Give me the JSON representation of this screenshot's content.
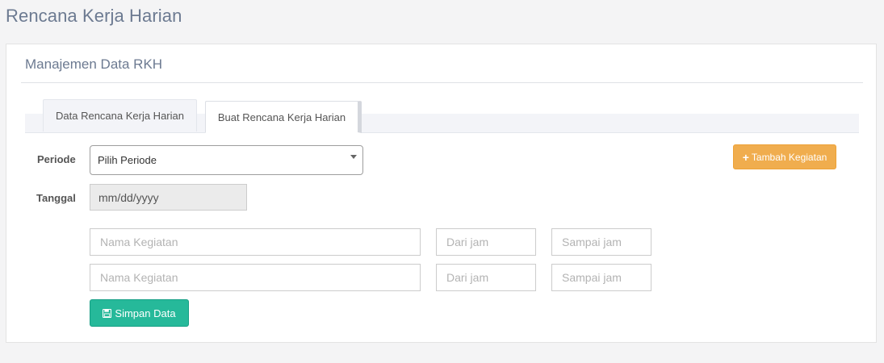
{
  "page": {
    "title": "Rencana Kerja Harian"
  },
  "card": {
    "title": "Manajemen Data RKH"
  },
  "tabs": [
    {
      "label": "Data Rencana Kerja Harian",
      "active": false
    },
    {
      "label": "Buat Rencana Kerja Harian",
      "active": true
    }
  ],
  "form": {
    "periode_label": "Periode",
    "periode_value": "Pilih Periode",
    "tanggal_label": "Tanggal",
    "tanggal_value": "mm/dd/yyyy",
    "tambah_button": "Tambah Kegiatan",
    "activities": [
      {
        "nama_placeholder": "Nama Kegiatan",
        "dari_placeholder": "Dari jam",
        "sampai_placeholder": "Sampai jam"
      },
      {
        "nama_placeholder": "Nama Kegiatan",
        "dari_placeholder": "Dari jam",
        "sampai_placeholder": "Sampai jam"
      }
    ],
    "simpan_button": "Simpan Data"
  },
  "colors": {
    "title": "#6c7a91",
    "warning_button": "#f0ad4e",
    "success_button": "#26b99a"
  },
  "icons": {
    "tambah": "plus-icon",
    "simpan": "floppy-disk-icon",
    "select": "caret-down-icon"
  }
}
